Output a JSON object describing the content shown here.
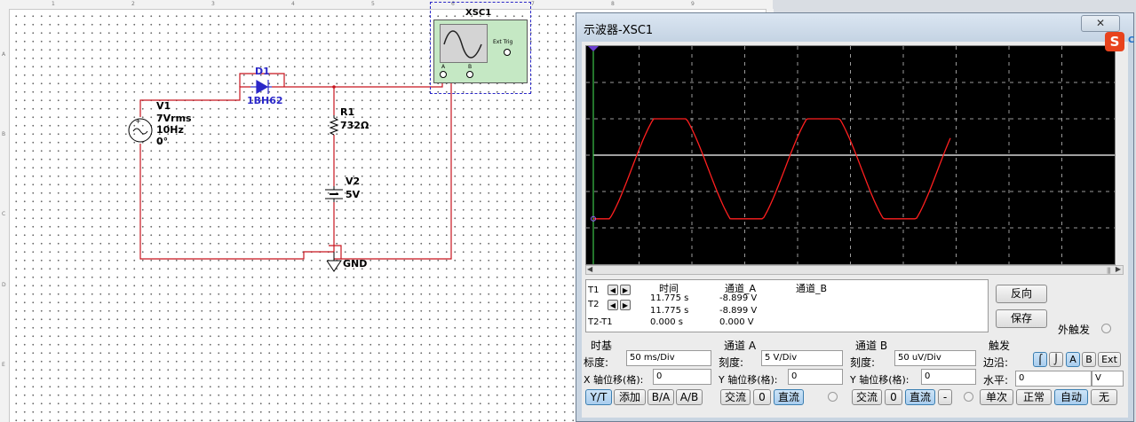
{
  "schematic": {
    "ruler_numbers": [
      "1",
      "2",
      "3",
      "4",
      "5",
      "6",
      "7",
      "8",
      "9"
    ],
    "ruler_letters": [
      "A",
      "B",
      "C",
      "D",
      "E"
    ],
    "v1": {
      "name": "V1",
      "line1": "7Vrms",
      "line2": "10Hz",
      "line3": "0°"
    },
    "d1": {
      "name": "D1",
      "model": "1BH62"
    },
    "r1": {
      "name": "R1",
      "value": "732Ω"
    },
    "v2": {
      "name": "V2",
      "value": "5V"
    },
    "gnd": "GND",
    "xsc1": {
      "name": "XSC1",
      "ext_trig": "Ext Trig",
      "ch_a": "A",
      "ch_b": "B"
    },
    "wire_color": "#c8141e",
    "part_color": "#2a27c8"
  },
  "oscilloscope": {
    "title": "示波器-XSC1",
    "close_label": "✕",
    "trace_color": "#ff1f1f",
    "readout": {
      "col_time": "时间",
      "col_a": "通道_A",
      "col_b": "通道_B",
      "t1": "T1",
      "t2": "T2",
      "t2t1": "T2-T1",
      "t1_time": "11.775 s",
      "t1_a": "-8.899 V",
      "t2_time": "11.775 s",
      "t2_a": "-8.899 V",
      "dt_time": "0.000 s",
      "dt_a": "0.000 V"
    },
    "buttons_right": {
      "reverse": "反向",
      "save": "保存",
      "ext_trigger": "外触发"
    },
    "timebase": {
      "title": "时基",
      "scale_label": "标度:",
      "scale_value": "50 ms/Div",
      "xpos_label": "X 轴位移(格):",
      "xpos_value": "0",
      "modes": [
        "Y/T",
        "添加",
        "B/A",
        "A/B"
      ]
    },
    "channel_a": {
      "title": "通道 A",
      "scale_label": "刻度:",
      "scale_value": "5  V/Div",
      "ypos_label": "Y 轴位移(格):",
      "ypos_value": "0",
      "coupling": [
        "交流",
        "0",
        "直流"
      ]
    },
    "channel_b": {
      "title": "通道 B",
      "scale_label": "刻度:",
      "scale_value": "50 uV/Div",
      "ypos_label": "Y 轴位移(格):",
      "ypos_value": "0",
      "coupling": [
        "交流",
        "0",
        "直流",
        "-"
      ]
    },
    "trigger": {
      "title": "触发",
      "edge_label": "边沿:",
      "level_label": "水平:",
      "level_value": "0",
      "level_unit": "V",
      "edge_buttons": [
        "A",
        "B",
        "Ext"
      ],
      "modes": [
        "单次",
        "正常",
        "自动",
        "无"
      ]
    }
  },
  "tray": {
    "logo_letter": "S",
    "logo_text": "C"
  }
}
